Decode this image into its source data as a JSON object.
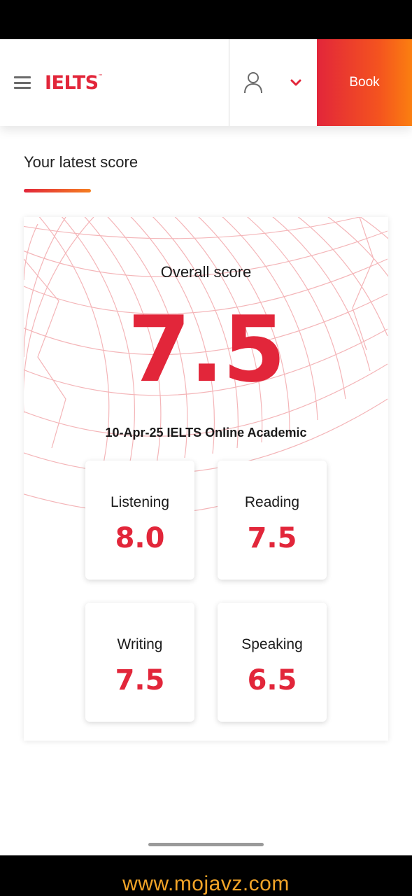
{
  "header": {
    "logo_text": "IELTS",
    "logo_tm": "™",
    "book_label": "Book"
  },
  "colors": {
    "brand_red": "#e2263a",
    "book_gradient_end": "#fb7f10",
    "pattern_line": "#f4b5b8",
    "watermark": "#f2a428"
  },
  "icons": {
    "menu": "hamburger-icon",
    "user": "user-icon",
    "dropdown": "chevron-down-icon"
  },
  "main": {
    "section_title": "Your latest score",
    "overall_label": "Overall score",
    "overall_score": "7.5",
    "test_info": "10-Apr-25 IELTS Online Academic",
    "modules": [
      {
        "name": "Listening",
        "score": "8.0"
      },
      {
        "name": "Reading",
        "score": "7.5"
      },
      {
        "name": "Writing",
        "score": "7.5"
      },
      {
        "name": "Speaking",
        "score": "6.5"
      }
    ]
  },
  "watermark": "www.mojavz.com"
}
